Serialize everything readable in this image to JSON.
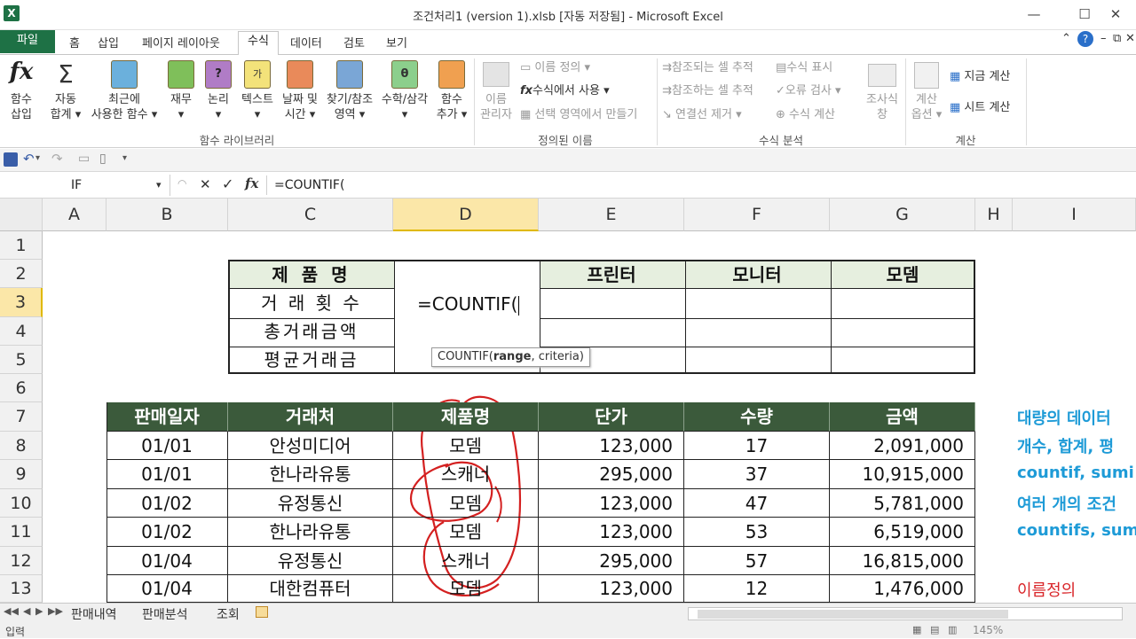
{
  "window": {
    "title": "조건처리1 (version 1).xlsb [자동 저장됨] - Microsoft Excel",
    "controls": {
      "minimize": "—",
      "maximize": "☐",
      "close": "✕"
    }
  },
  "ribbon_tabs": [
    "파일",
    "홈",
    "삽입",
    "페이지 레이아웃",
    "수식",
    "데이터",
    "검토",
    "보기"
  ],
  "active_tab": "수식",
  "ribbon": {
    "insert_function": [
      "함수",
      "삽입"
    ],
    "autosum": [
      "자동",
      "합계 ▾"
    ],
    "recent": [
      "최근에",
      "사용한 함수 ▾"
    ],
    "financial": [
      "재무",
      "▾"
    ],
    "logical": [
      "논리",
      "▾"
    ],
    "text": [
      "텍스트",
      "▾"
    ],
    "datetime": [
      "날짜 및",
      "시간 ▾"
    ],
    "lookup": [
      "찾기/참조",
      "영역 ▾"
    ],
    "math": [
      "수학/삼각",
      "▾"
    ],
    "more": [
      "함수",
      "추가 ▾"
    ],
    "group_library": "함수 라이브러리",
    "name_manager": [
      "이름",
      "관리자"
    ],
    "define_name": "이름 정의 ▾",
    "use_in_formula": "수식에서 사용 ▾",
    "create_from_selection": "선택 영역에서 만들기",
    "group_defined": "정의된 이름",
    "trace_precedents": "참조되는 셀 추적",
    "trace_dependents": "참조하는 셀 추적",
    "remove_arrows": "연결선 제거 ▾",
    "show_formulas": "수식 표시",
    "error_checking": "오류 검사 ▾",
    "evaluate_formula": "수식 계산",
    "watch_window": [
      "조사식",
      "창"
    ],
    "group_auditing": "수식 분석",
    "calc_options": [
      "계산",
      "옵션 ▾"
    ],
    "calc_now": "지금 계산",
    "calc_sheet": "시트 계산",
    "group_calc": "계산"
  },
  "formula_bar": {
    "name_box": "IF",
    "cancel": "✕",
    "enter": "✓",
    "fx": "fx",
    "formula": "=COUNTIF("
  },
  "columns": [
    "A",
    "B",
    "C",
    "D",
    "E",
    "F",
    "G",
    "H",
    "I"
  ],
  "rows": [
    "1",
    "2",
    "3",
    "4",
    "5",
    "6",
    "7",
    "8",
    "9",
    "10",
    "11",
    "12",
    "13"
  ],
  "summary": {
    "header_label": "제  품  명",
    "products": [
      "프린터",
      "모니터",
      "모뎀"
    ],
    "row_labels": [
      "거 래 횟 수",
      "총거래금액",
      "평균거래금"
    ],
    "editing_cell": "=COUNTIF("
  },
  "tooltip": {
    "fn": "COUNTIF(",
    "arg1": "range",
    "rest": ", criteria)"
  },
  "table": {
    "headers": [
      "판매일자",
      "거래처",
      "제품명",
      "단가",
      "수량",
      "금액"
    ],
    "rows": [
      [
        "01/01",
        "안성미디어",
        "모뎀",
        "123,000",
        "17",
        "2,091,000"
      ],
      [
        "01/01",
        "한나라유통",
        "스캐너",
        "295,000",
        "37",
        "10,915,000"
      ],
      [
        "01/02",
        "유정통신",
        "모뎀",
        "123,000",
        "47",
        "5,781,000"
      ],
      [
        "01/02",
        "한나라유통",
        "모뎀",
        "123,000",
        "53",
        "6,519,000"
      ],
      [
        "01/04",
        "유정통신",
        "스캐너",
        "295,000",
        "57",
        "16,815,000"
      ],
      [
        "01/04",
        "대한컴퓨터",
        "모뎀",
        "123,000",
        "12",
        "1,476,000"
      ]
    ]
  },
  "side_notes": [
    "대량의 데이터",
    "개수, 합계, 평",
    "countif, sumi",
    "여러 개의 조건",
    "countifs, sum"
  ],
  "name_define_note": "이름정의",
  "sheets": [
    "판매내역",
    "판매분석",
    "조회"
  ],
  "status": {
    "mode": "입력",
    "zoom": "145%"
  },
  "colors": {
    "accent": "#1e7145",
    "table_header": "#3b5a3b",
    "note_blue": "#1e9bd7",
    "note_red": "#d9262a",
    "annotation": "#d42020"
  }
}
